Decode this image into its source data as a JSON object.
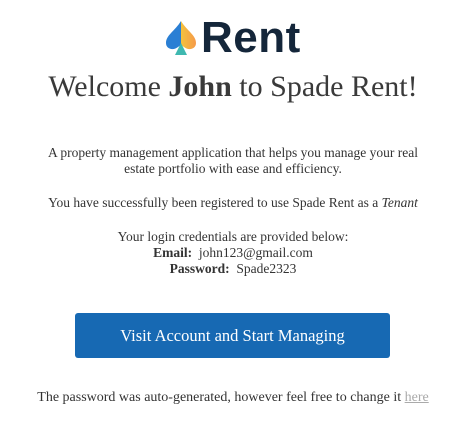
{
  "logo": {
    "text": "Rent",
    "icon": "spade-icon",
    "colors": {
      "blue": "#2a7fd4",
      "yellow": "#f5c23d",
      "teal": "#3fb8b0",
      "text": "#14263a"
    }
  },
  "welcome": {
    "prefix": "Welcome ",
    "name": "John",
    "suffix": " to Spade Rent!"
  },
  "intro_line1": "A property management application that helps you manage your real",
  "intro_line2": "estate portfolio with ease and efficiency.",
  "registered_text": "You have successfully been registered to use Spade Rent as a ",
  "role": "Tenant",
  "credentials_intro": "Your login credentials are provided below:",
  "email_label": "Email:",
  "email_value": "john123@gmail.com",
  "password_label": "Password:",
  "password_value": "Spade2323",
  "button_label": "Visit Account and Start Managing",
  "button_color": "#1769b3",
  "footer_text": "The password was auto-generated, however feel free to change it ",
  "footer_link": "here"
}
